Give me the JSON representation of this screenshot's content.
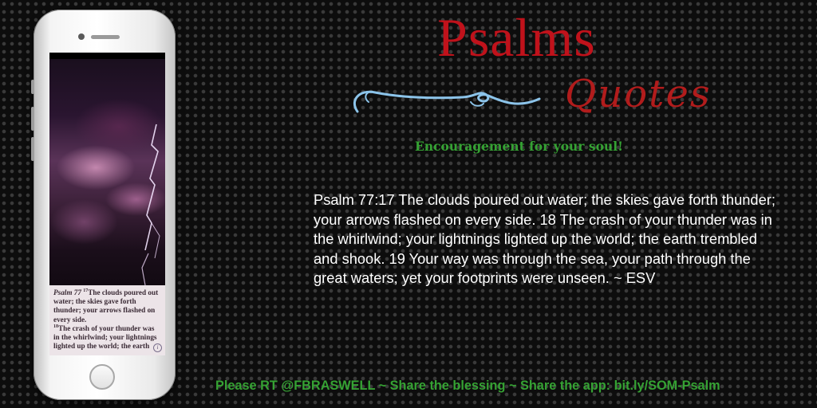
{
  "title": {
    "main": "Psalms",
    "script": "Quotes",
    "tagline": "Encouragement for your soul!"
  },
  "verse_text": "Psalm 77:17 The clouds poured out water; the skies gave forth thunder; your arrows flashed on every side. 18 The crash of your thunder was in the whirlwind; your lightnings lighted up the world; the earth trembled and shook. 19 Your way was through the sea, your path through the great waters; yet your footprints were unseen. ~ ESV",
  "footer": "Please RT @FBRASWELL ~ Share the blessing ~ Share the app: bit.ly/SOM-Psalm",
  "phone_screen": {
    "reference": "Psalm 77",
    "verse_17_number": "17",
    "verse_17_text": "The clouds poured out water; the skies gave forth thunder; your arrows flashed on every side.",
    "verse_18_number": "18",
    "verse_18_text": "The crash of your thunder was in the whirlwind; your lightnings lighted up the world; the earth",
    "info_glyph": "i"
  },
  "colors": {
    "title_red": "#c0121b",
    "script_red": "#b11c1c",
    "green": "#35a233",
    "flourish_blue": "#8cc4ea",
    "background": "#0d0d0d"
  },
  "icons": {
    "info": "info-icon",
    "flourish": "flourish-icon",
    "home": "home-button-icon"
  }
}
